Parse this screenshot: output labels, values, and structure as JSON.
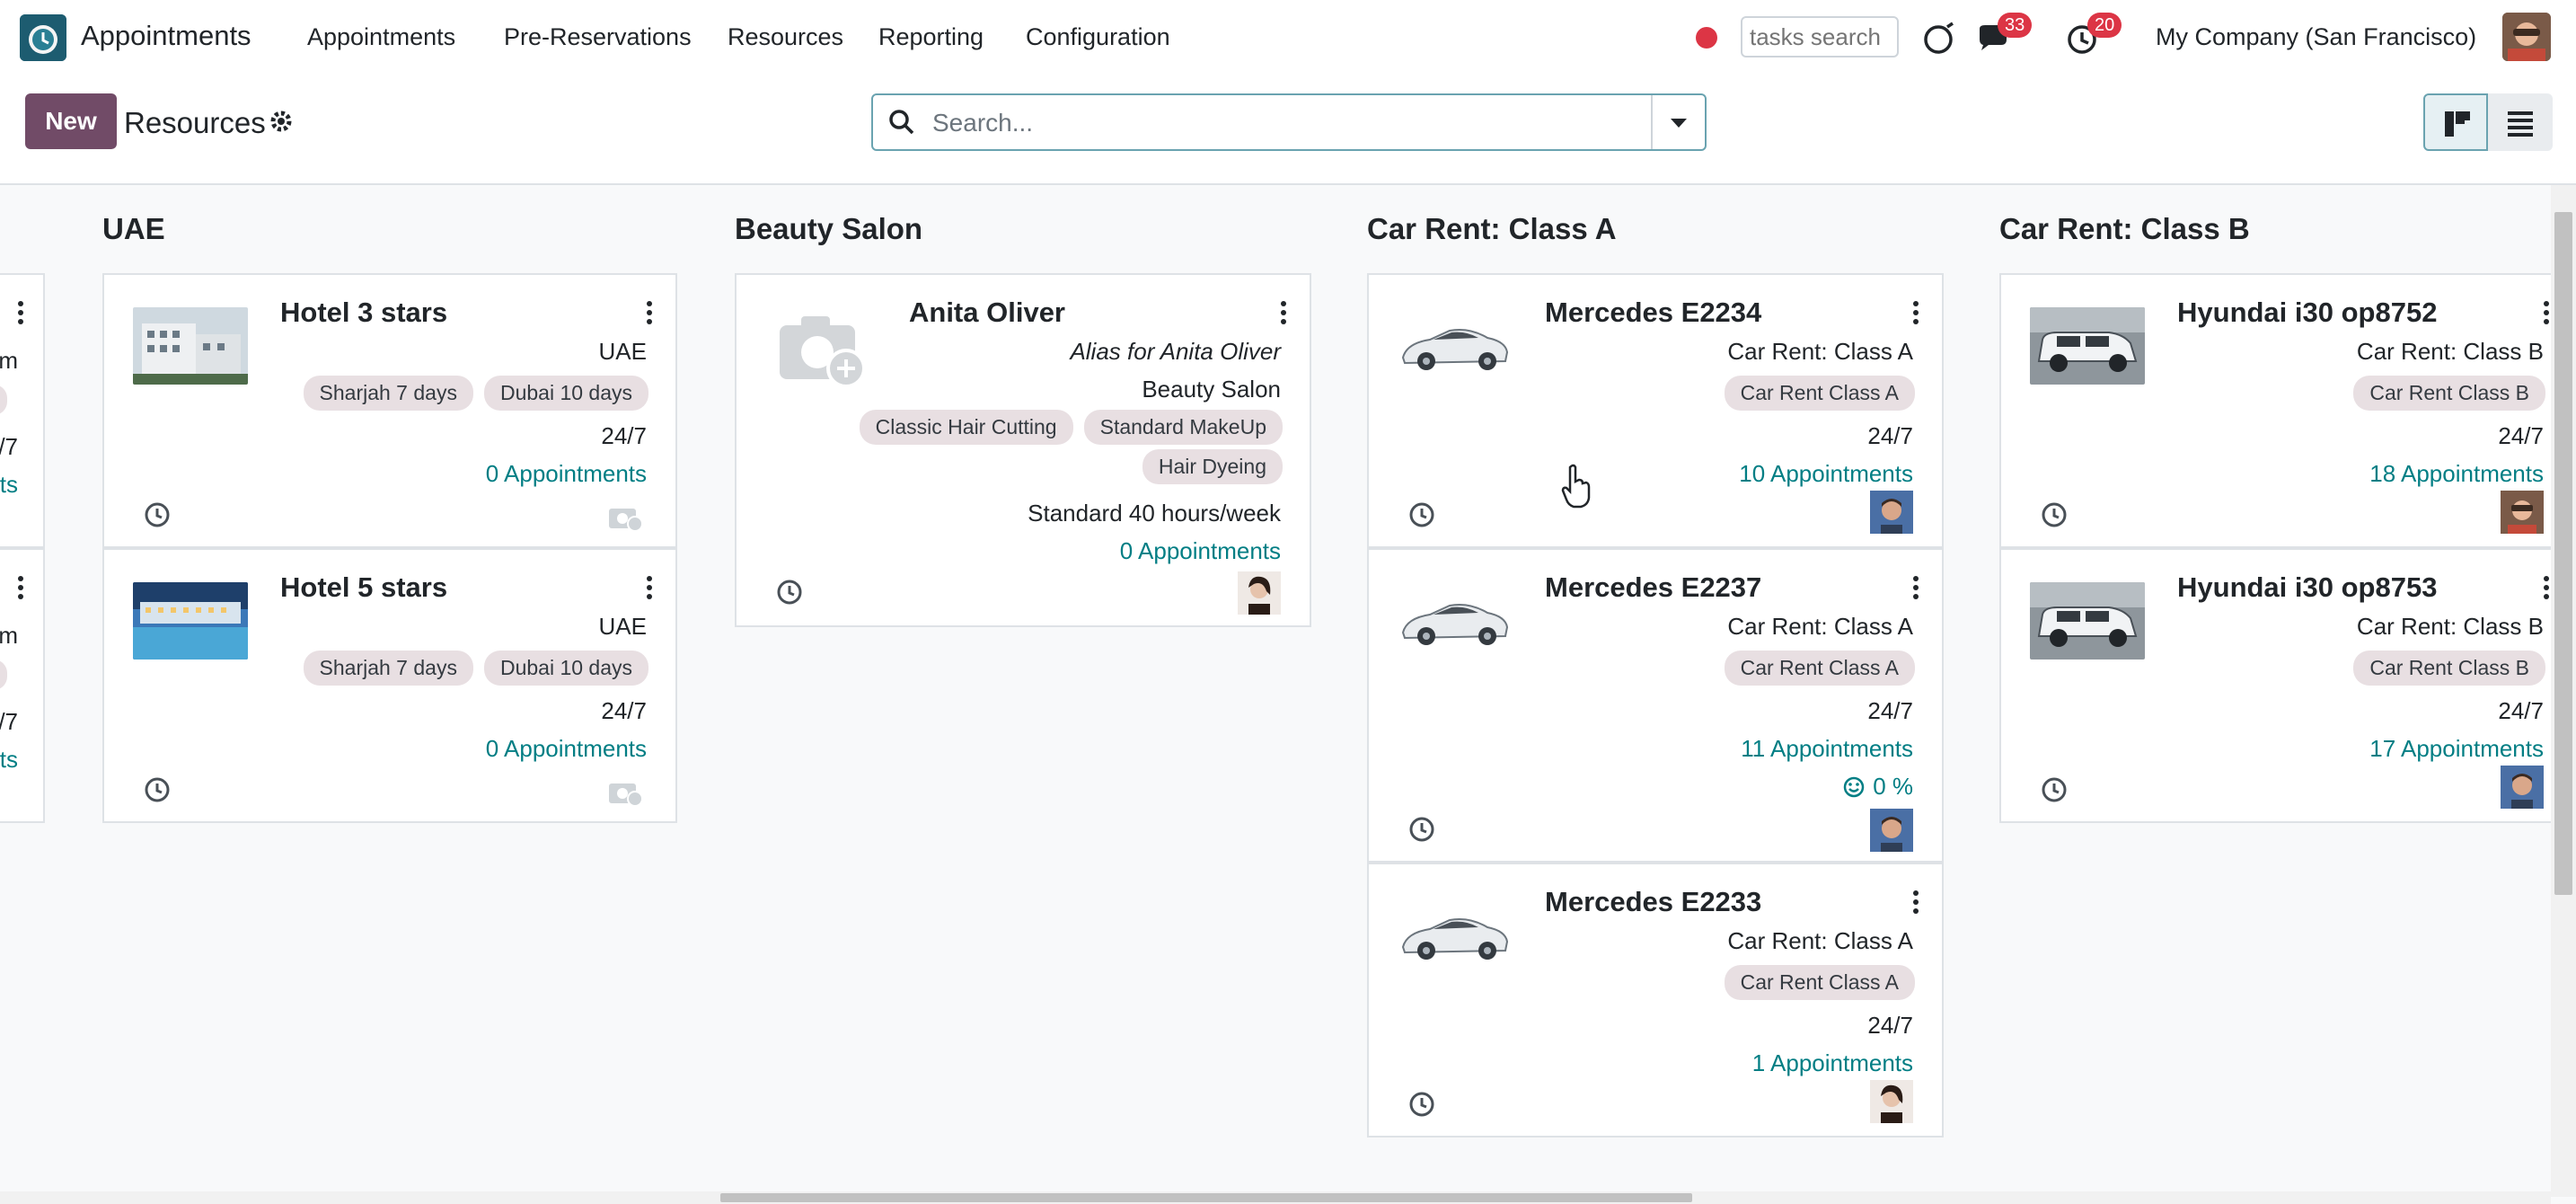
{
  "app": {
    "name": "Appointments"
  },
  "navbar": {
    "menu": [
      "Appointments",
      "Pre-Reservations",
      "Resources",
      "Reporting",
      "Configuration"
    ],
    "tasks_search_placeholder": "tasks search",
    "messages_count": "33",
    "activities_count": "20",
    "company": "My Company (San Francisco)"
  },
  "control_panel": {
    "new_label": "New",
    "breadcrumb": "Resources",
    "search_placeholder": "Search..."
  },
  "columns": [
    {
      "title": "UAE"
    },
    {
      "title": "Beauty Salon"
    },
    {
      "title": "Car Rent: Class A"
    },
    {
      "title": "Car Rent: Class B"
    }
  ],
  "left_partial": {
    "rows": [
      {
        "l1": "m",
        "l2": "/7",
        "l3": "ts"
      },
      {
        "l1": "m",
        "l2": "/7",
        "l3": "ts"
      }
    ]
  },
  "cards": {
    "hotel3": {
      "title": "Hotel 3 stars",
      "location": "UAE",
      "tags": [
        "Sharjah 7 days",
        "Dubai 10 days"
      ],
      "hours": "24/7",
      "appointments": "0 Appointments"
    },
    "hotel5": {
      "title": "Hotel 5 stars",
      "location": "UAE",
      "tags": [
        "Sharjah 7 days",
        "Dubai 10 days"
      ],
      "hours": "24/7",
      "appointments": "0 Appointments"
    },
    "anita": {
      "title": "Anita Oliver",
      "alias": "Alias for Anita Oliver",
      "location": "Beauty Salon",
      "tags": [
        "Classic Hair Cutting",
        "Standard MakeUp",
        "Hair Dyeing"
      ],
      "hours": "Standard 40 hours/week",
      "appointments": "0 Appointments"
    },
    "e2234": {
      "title": "Mercedes E2234",
      "location": "Car Rent: Class A",
      "tag": "Car Rent Class A",
      "hours": "24/7",
      "appointments": "10 Appointments"
    },
    "e2237": {
      "title": "Mercedes E2237",
      "location": "Car Rent: Class A",
      "tag": "Car Rent Class A",
      "hours": "24/7",
      "appointments": "11 Appointments",
      "satisfaction": "0 %"
    },
    "e2233": {
      "title": "Mercedes E2233",
      "location": "Car Rent: Class A",
      "tag": "Car Rent Class A",
      "hours": "24/7",
      "appointments": "1 Appointments"
    },
    "op8752": {
      "title": "Hyundai i30 op8752",
      "location": "Car Rent: Class B",
      "tag": "Car Rent Class B",
      "hours": "24/7",
      "appointments": "18 Appointments"
    },
    "op8753": {
      "title": "Hyundai i30 op8753",
      "location": "Car Rent: Class B",
      "tag": "Car Rent Class B",
      "hours": "24/7",
      "appointments": "17 Appointments"
    }
  },
  "colors": {
    "brand": "#714b67",
    "link": "#017e84",
    "badge": "#dc3545",
    "tag_bg": "#e8dfe2"
  }
}
